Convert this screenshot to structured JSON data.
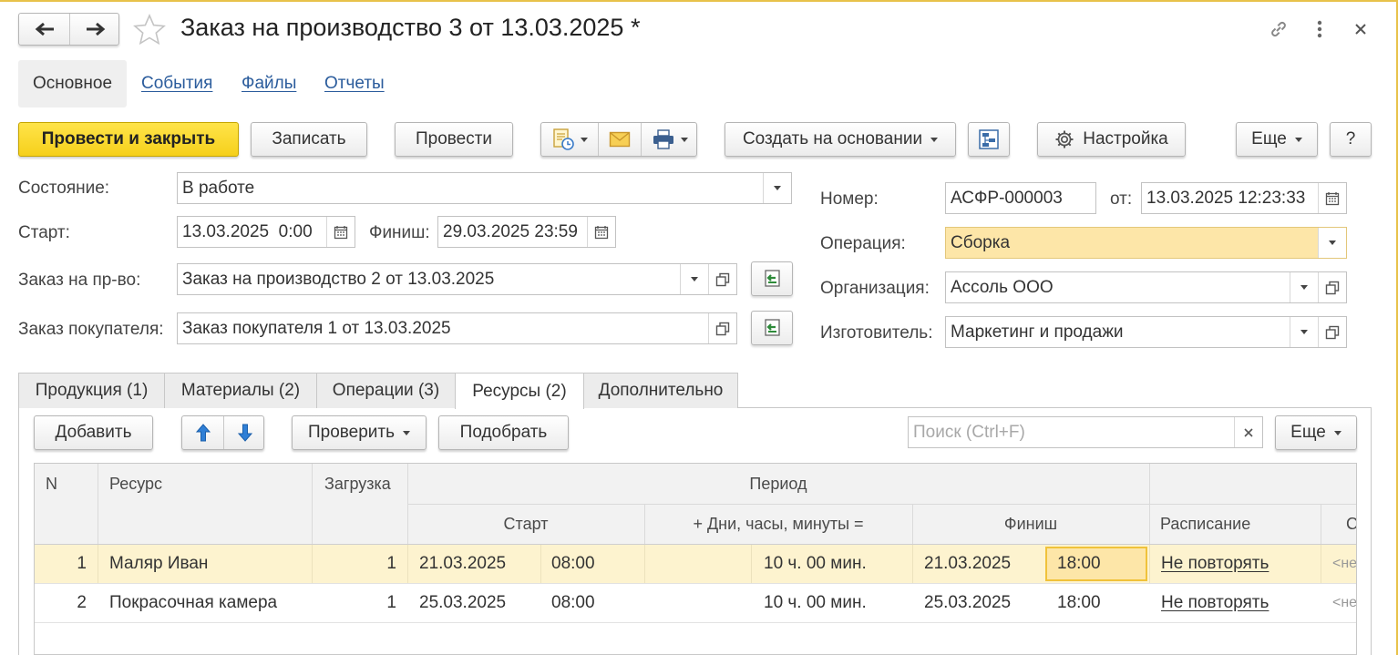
{
  "window": {
    "title": "Заказ на производство 3 от 13.03.2025 *"
  },
  "sections": [
    {
      "label": "Основное"
    },
    {
      "label": "События"
    },
    {
      "label": "Файлы"
    },
    {
      "label": "Отчеты"
    }
  ],
  "toolbar": {
    "post_close": "Провести и закрыть",
    "save": "Записать",
    "post": "Провести",
    "create_based": "Создать на основании",
    "settings": "Настройка",
    "more": "Еще",
    "help": "?"
  },
  "form": {
    "state_label": "Состояние:",
    "state_value": "В работе",
    "start_label": "Старт:",
    "start_value": "13.03.2025  0:00",
    "finish_label": "Финиш:",
    "finish_value": "29.03.2025 23:59",
    "prod_order_label": "Заказ на пр-во:",
    "prod_order_value": "Заказ на производство 2 от 13.03.2025",
    "customer_order_label": "Заказ покупателя:",
    "customer_order_value": "Заказ покупателя 1 от 13.03.2025",
    "number_label": "Номер:",
    "number_value": "АСФР-000003",
    "date_label": "от:",
    "date_value": "13.03.2025 12:23:33",
    "operation_label": "Операция:",
    "operation_value": "Сборка",
    "org_label": "Организация:",
    "org_value": "Ассоль ООО",
    "maker_label": "Изготовитель:",
    "maker_value": "Маркетинг и продажи"
  },
  "tabs": [
    {
      "label": "Продукция (1)"
    },
    {
      "label": "Материалы (2)"
    },
    {
      "label": "Операции (3)"
    },
    {
      "label": "Ресурсы (2)"
    },
    {
      "label": "Дополнительно"
    }
  ],
  "table_toolbar": {
    "add": "Добавить",
    "check": "Проверить",
    "pick": "Подобрать",
    "search_placeholder": "Поиск (Ctrl+F)",
    "more": "Еще"
  },
  "table": {
    "headers": {
      "n": "N",
      "resource": "Ресурс",
      "load": "Загрузка",
      "period": "Период",
      "start": "Старт",
      "duration": "+ Дни, часы, минуты =",
      "finish": "Финиш",
      "schedule": "Расписание",
      "extra": "С"
    },
    "rows": [
      {
        "n": "1",
        "resource": "Маляр Иван",
        "load": "1",
        "start_date": "21.03.2025",
        "start_time": "08:00",
        "duration": "10 ч. 00 мин.",
        "finish_date": "21.03.2025",
        "finish_time": "18:00",
        "schedule": "Не повторять",
        "extra": "<не"
      },
      {
        "n": "2",
        "resource": "Покрасочная камера",
        "load": "1",
        "start_date": "25.03.2025",
        "start_time": "08:00",
        "duration": "10 ч. 00 мин.",
        "finish_date": "25.03.2025",
        "finish_time": "18:00",
        "schedule": "Не повторять",
        "extra": "<не"
      }
    ]
  },
  "colors": {
    "accent_yellow": "#f6d01b",
    "selected_row": "#fdf3cf",
    "link_blue": "#2b5c9c"
  }
}
